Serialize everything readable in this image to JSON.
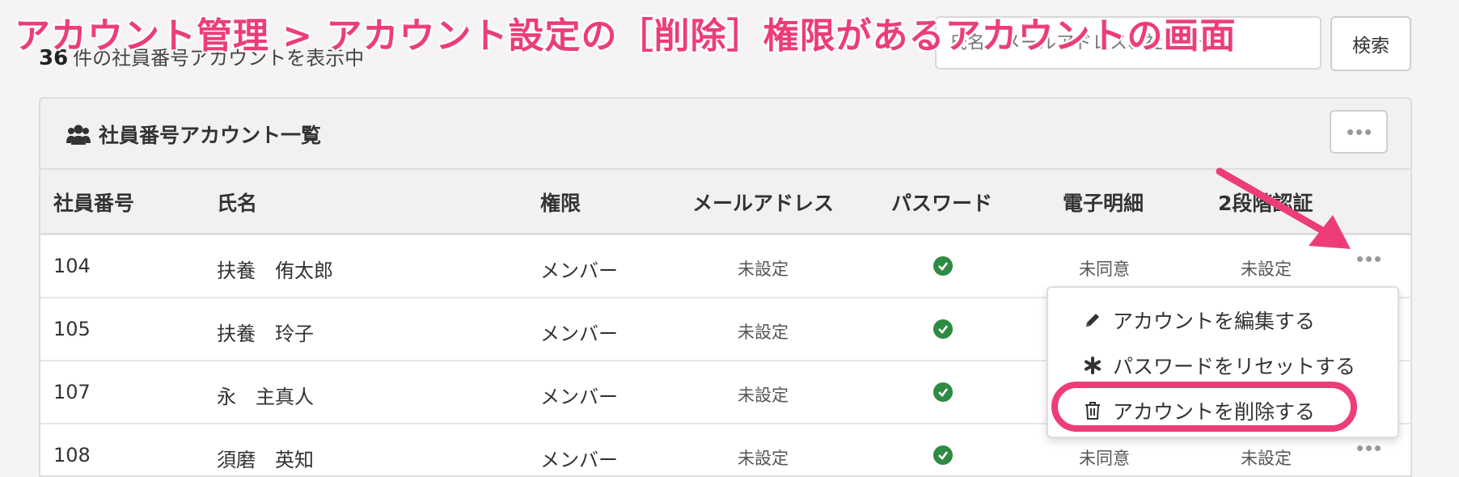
{
  "annotation": {
    "title": "アカウント管理 > アカウント設定の［削除］権限があるアカウントの画面"
  },
  "toolbar": {
    "count": "36",
    "count_suffix": "件の社員番号アカウントを表示中",
    "search_placeholder": "氏名、メールアドレス、社員番号",
    "search_button": "検索"
  },
  "panel": {
    "title": "社員番号アカウント一覧",
    "title_icon": "users-icon"
  },
  "table": {
    "columns": [
      "社員番号",
      "氏名",
      "権限",
      "メールアドレス",
      "パスワード",
      "電子明細",
      "2段階認証"
    ],
    "rows": [
      {
        "id": "104",
        "name": "扶養　侑太郎",
        "role": "メンバー",
        "email": "未設定",
        "password": "check",
        "payslip": "未同意",
        "two_factor": "未設定"
      },
      {
        "id": "105",
        "name": "扶養　玲子",
        "role": "メンバー",
        "email": "未設定",
        "password": "check",
        "payslip": "",
        "two_factor": ""
      },
      {
        "id": "107",
        "name": "永　主真人",
        "role": "メンバー",
        "email": "未設定",
        "password": "check",
        "payslip": "",
        "two_factor": ""
      },
      {
        "id": "108",
        "name": "須磨　英知",
        "role": "メンバー",
        "email": "未設定",
        "password": "check",
        "payslip": "未同意",
        "two_factor": "未設定"
      }
    ]
  },
  "dropdown": {
    "items": [
      {
        "label": "アカウントを編集する",
        "icon": "pencil-icon"
      },
      {
        "label": "パスワードをリセットする",
        "icon": "asterisk-icon"
      },
      {
        "label": "アカウントを削除する",
        "icon": "trash-icon"
      }
    ]
  },
  "colors": {
    "annotation": "#ec3d7a",
    "check": "#2f8a43",
    "background": "#f5f4f2"
  }
}
